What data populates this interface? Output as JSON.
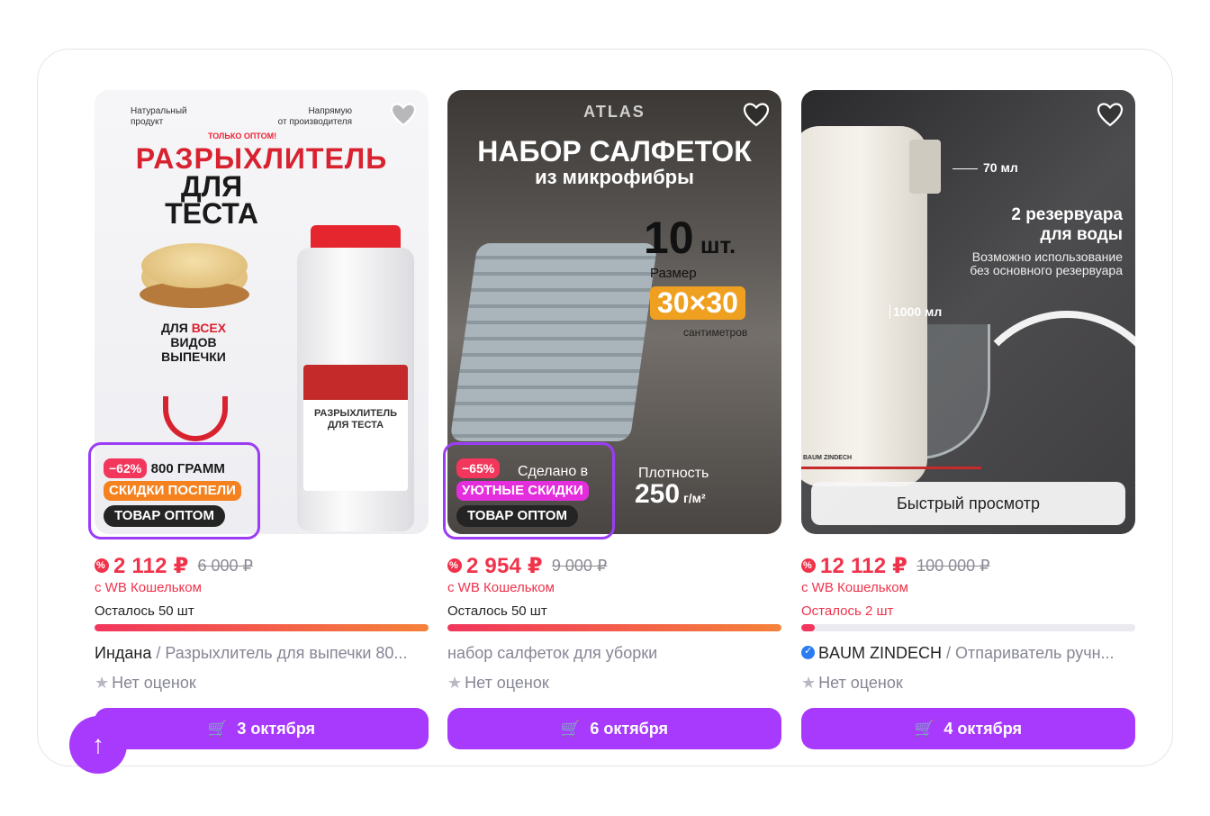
{
  "products": [
    {
      "image_text": {
        "note_left": "Натуральный\nпродукт",
        "note_right": "Напрямую\nот производителя",
        "note_red": "ТОЛЬКО ОПТОМ!",
        "headline": "РАЗРЫХЛИТЕЛЬ",
        "headline2": "ДЛЯ\nТЕСТА",
        "small_before": "ДЛЯ ",
        "small_accent": "ВСЕХ",
        "small_after": "ВИДОВ\nВЫПЕЧКИ",
        "jar_label": "РАЗРЫХЛИТЕЛЬ\nДЛЯ ТЕСТА",
        "weight": "800 ГРАММ"
      },
      "discount": "−62%",
      "promo": "СКИДКИ ПОСПЕЛИ",
      "wholesale": "ТОВАР ОПТОМ",
      "price": "2 112 ₽",
      "old_price": "6 000 ₽",
      "wallet": "с WB Кошельком",
      "stock": "Осталось 50 шт",
      "stock_fraction": 1.0,
      "brand": "Индана",
      "title": " / Разрыхлитель для выпечки 80...",
      "rating": "Нет оценок",
      "delivery": "3 октября"
    },
    {
      "image_text": {
        "logo": "ATLAS",
        "headline": "НАБОР САЛФЕТОК",
        "subheadline": "из микрофибры",
        "count": "10",
        "count_unit": " шт.",
        "size_label": "Размер",
        "size": "30×30",
        "size_unit": "сантиметров",
        "made": "Сделано в",
        "density_label": "Плотность",
        "density": "250",
        "density_unit": " г/м²"
      },
      "discount": "−65%",
      "promo": "УЮТНЫЕ СКИДКИ",
      "wholesale": "ТОВАР ОПТОМ",
      "price": "2 954 ₽",
      "old_price": "9 000 ₽",
      "wallet": "с WB Кошельком",
      "stock": "Осталось 50 шт",
      "stock_fraction": 1.0,
      "brand": "",
      "title": "набор салфеток для уборки",
      "rating": "Нет оценок",
      "delivery": "6 октября"
    },
    {
      "image_text": {
        "ml70": "70 мл",
        "headline": "2 резервуара\nдля воды",
        "sub": "Возможно использование\nбез основного резервуара",
        "ml1000": "1000 мл",
        "device_brand": "BAUM ZINDECH"
      },
      "quick_view": "Быстрый просмотр",
      "price": "12 112 ₽",
      "old_price": "100 000 ₽",
      "wallet": "с WB Кошельком",
      "stock": "Осталось 2 шт",
      "stock_fraction": 0.04,
      "brand": "BAUM ZINDECH",
      "title": " / Отпариватель ручн...",
      "rating": "Нет оценок",
      "delivery": "4 октября"
    }
  ],
  "colors": {
    "accent": "#a73afd",
    "price": "#f0334b",
    "highlight": "#9b3df5"
  },
  "icons": [
    "heart-icon",
    "cart-icon",
    "star-icon",
    "verified-icon",
    "arrow-up-icon",
    "discount-icon"
  ]
}
